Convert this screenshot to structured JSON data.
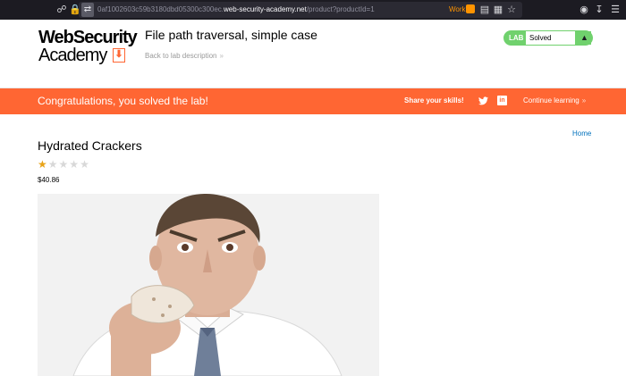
{
  "browser": {
    "url_prefix": "0af1002603c59b3180dbd05300c300ec.",
    "url_host": "web-security-academy.net",
    "url_path": "/product?productId=1",
    "container_label": "Work"
  },
  "header": {
    "logo_line1": "WebSecurity",
    "logo_line2": "Academy",
    "lab_title": "File path traversal, simple case",
    "back_link": "Back to lab description",
    "lab_badge": "LAB",
    "lab_status": "Solved"
  },
  "banner": {
    "message": "Congratulations, you solved the lab!",
    "share_label": "Share your skills!",
    "continue_label": "Continue learning"
  },
  "nav": {
    "home_label": "Home"
  },
  "product": {
    "name": "Hydrated Crackers",
    "rating": 1,
    "rating_max": 5,
    "price": "$40.86"
  },
  "colors": {
    "brand_orange": "#ff6633",
    "solved_green": "#70d16d",
    "link_blue": "#0071bc",
    "star_gold": "#e8a317"
  }
}
